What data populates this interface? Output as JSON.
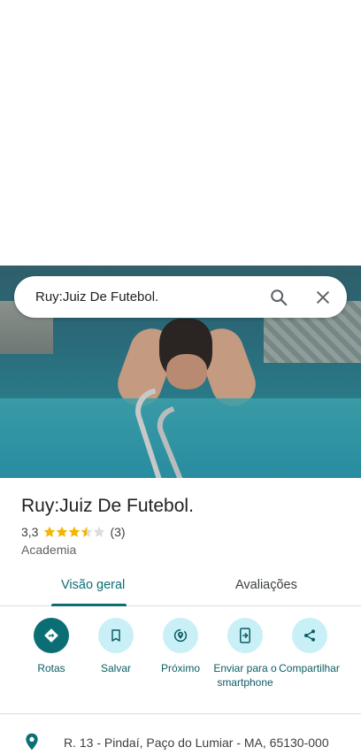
{
  "search": {
    "query": "Ruy:Juiz De Futebol."
  },
  "place": {
    "name": "Ruy:Juiz De Futebol.",
    "rating": "3,3",
    "rating_value": 3.3,
    "review_count": "(3)",
    "category": "Academia"
  },
  "tabs": [
    {
      "label": "Visão geral",
      "selected": true
    },
    {
      "label": "Avaliações",
      "selected": false
    }
  ],
  "actions": [
    {
      "label": "Rotas",
      "icon": "directions-icon"
    },
    {
      "label": "Salvar",
      "icon": "bookmark-icon"
    },
    {
      "label": "Próximo",
      "icon": "nearby-icon"
    },
    {
      "label": "Enviar para o smartphone",
      "icon": "send-to-phone-icon"
    },
    {
      "label": "Compartilhar",
      "icon": "share-icon"
    }
  ],
  "address": "R. 13 - Pindaí, Paço do Lumiar - MA, 65130-000",
  "colors": {
    "accent": "#0b6e74",
    "action_bg": "#c8f0f6",
    "star": "#f4b400"
  }
}
